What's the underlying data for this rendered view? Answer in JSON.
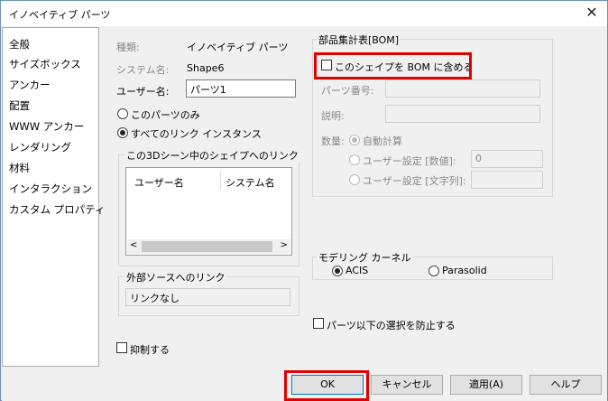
{
  "window": {
    "title": "イノベイティブ パーツ"
  },
  "sidebar": {
    "items": [
      "全般",
      "サイズボックス",
      "アンカー",
      "配置",
      "WWW アンカー",
      "レンダリング",
      "材料",
      "インタラクション",
      "カスタム プロパティ"
    ]
  },
  "general": {
    "type_label": "種類:",
    "type_value": "イノベイティブ パーツ",
    "system_name_label": "システム名:",
    "system_name_value": "Shape6",
    "user_name_label": "ユーザー名:",
    "user_name_value": "パーツ1",
    "radio_this_part": "このパーツのみ",
    "radio_all_links": "すべてのリンク インスタンス",
    "links_group_title": "この3Dシーン中のシェイプへのリンク",
    "links_columns": [
      "ユーザー名",
      "システム名"
    ],
    "external_group_title": "外部ソースへのリンク",
    "external_value": "リンクなし",
    "suppress_label": "抑制する"
  },
  "bom": {
    "group_title": "部品集計表[BOM]",
    "include_label": "このシェイプを BOM に含める",
    "part_number_label": "パーツ番号:",
    "description_label": "説明:",
    "quantity_label": "数量:",
    "auto_calc": "自動計算",
    "user_numeric": "ユーザー設定 [数値]:",
    "user_numeric_value": "0",
    "user_string": "ユーザー設定 [文字列]:"
  },
  "kernel": {
    "group_title": "モデリング カーネル",
    "acis": "ACIS",
    "parasolid": "Parasolid"
  },
  "prevent_select_label": "パーツ以下の選択を防止する",
  "buttons": {
    "ok": "OK",
    "cancel": "キャンセル",
    "apply": "適用(A)",
    "help": "ヘルプ"
  },
  "colors": {
    "highlight": "#e00000",
    "accent": "#0078d7"
  }
}
